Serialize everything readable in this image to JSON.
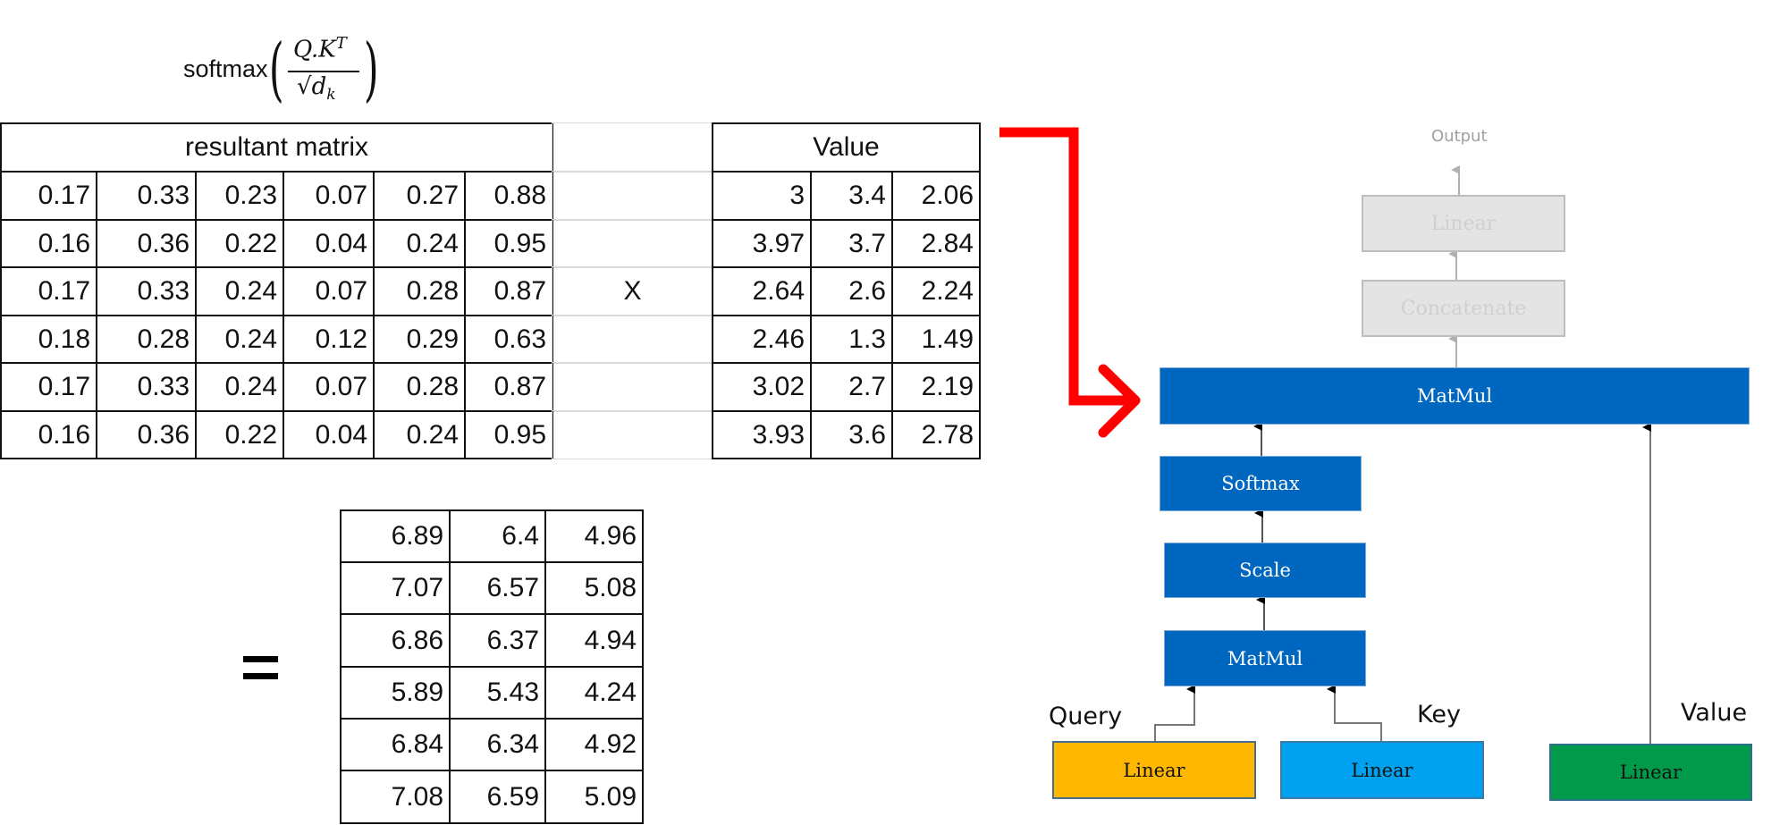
{
  "formula": {
    "function": "softmax",
    "numerator": "Q.K",
    "numerator_superscript": "T",
    "denominator": "√d",
    "denominator_subscript": "k"
  },
  "left_table": {
    "header": "resultant matrix",
    "rows": [
      [
        "0.17",
        "0.33",
        "0.23",
        "0.07",
        "0.27",
        "0.88"
      ],
      [
        "0.16",
        "0.36",
        "0.22",
        "0.04",
        "0.24",
        "0.95"
      ],
      [
        "0.17",
        "0.33",
        "0.24",
        "0.07",
        "0.28",
        "0.87"
      ],
      [
        "0.18",
        "0.28",
        "0.24",
        "0.12",
        "0.29",
        "0.63"
      ],
      [
        "0.17",
        "0.33",
        "0.24",
        "0.07",
        "0.28",
        "0.87"
      ],
      [
        "0.16",
        "0.36",
        "0.22",
        "0.04",
        "0.24",
        "0.95"
      ]
    ]
  },
  "operator": "X",
  "value_table": {
    "header": "Value",
    "rows": [
      [
        "3",
        "3.4",
        "2.06"
      ],
      [
        "3.97",
        "3.7",
        "2.84"
      ],
      [
        "2.64",
        "2.6",
        "2.24"
      ],
      [
        "2.46",
        "1.3",
        "1.49"
      ],
      [
        "3.02",
        "2.7",
        "2.19"
      ],
      [
        "3.93",
        "3.6",
        "2.78"
      ]
    ]
  },
  "equals_sign": "=",
  "result_table": {
    "rows": [
      [
        "6.89",
        "6.4",
        "4.96"
      ],
      [
        "7.07",
        "6.57",
        "5.08"
      ],
      [
        "6.86",
        "6.37",
        "4.94"
      ],
      [
        "5.89",
        "5.43",
        "4.24"
      ],
      [
        "6.84",
        "6.34",
        "4.92"
      ],
      [
        "7.08",
        "6.59",
        "5.09"
      ]
    ]
  },
  "diagram": {
    "output_label": "Output",
    "linear_out": "Linear",
    "concatenate": "Concatenate",
    "matmul_top": "MatMul",
    "softmax": "Softmax",
    "scale": "Scale",
    "matmul_bottom": "MatMul",
    "query_label": "Query",
    "key_label": "Key",
    "value_label": "Value",
    "query_linear": "Linear",
    "key_linear": "Linear",
    "value_linear": "Linear",
    "colors": {
      "blue": "#0067c1",
      "query": "#ffb700",
      "key": "#00a1ef",
      "value": "#009a4a",
      "faded": "#e4e4e4",
      "pointer_arrow": "#ff0000"
    }
  }
}
